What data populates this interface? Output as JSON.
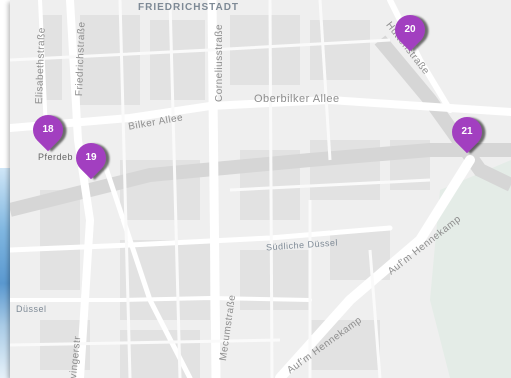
{
  "map": {
    "labels": {
      "district": "FRIEDRICHSTADT",
      "elisabethstrasse": "Elisabethstraße",
      "friedrichstrasse": "Friedrichstraße",
      "corneliusstrasse": "Corneliusstraße",
      "oberbilker_allee": "Oberbilker Allee",
      "bilker_allee": "Bilker Allee",
      "huettenstrasse": "Hüttenstraße",
      "pferdeb": "Pferdeb",
      "suedliche_duessel": "Südliche Düssel",
      "am_hennekamp_1": "Auf'm Hennekamp",
      "am_hennekamp_2": "Auf'm Hennekamp",
      "duessel": "Düssel",
      "mecumstrasse": "Mecumstraße",
      "vingerstr": "vingerstr"
    },
    "markers": [
      {
        "id": "18",
        "color": "#a23fc0"
      },
      {
        "id": "19",
        "color": "#a23fc0"
      },
      {
        "id": "20",
        "color": "#a23fc0"
      },
      {
        "id": "21",
        "color": "#a23fc0"
      }
    ]
  }
}
